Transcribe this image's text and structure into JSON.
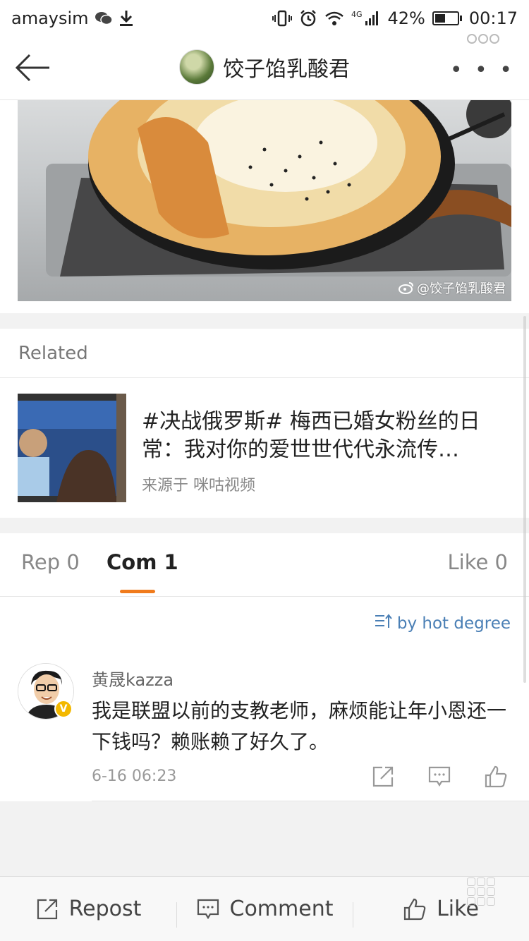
{
  "status_bar": {
    "carrier": "amaysim",
    "network": "4G",
    "battery": "42%",
    "time": "00:17"
  },
  "header": {
    "title": "饺子馅乳酸君",
    "more_label": "• • •"
  },
  "post_image": {
    "watermark": "@饺子馅乳酸君"
  },
  "related": {
    "title": "Related",
    "item": {
      "headline": "#决战俄罗斯# 梅西已婚女粉丝的日常：我对你的爱世世代代永流传…",
      "source": "来源于 咪咕视频"
    }
  },
  "tabs": {
    "repost": "Rep 0",
    "comments": "Com 1",
    "likes": "Like 0"
  },
  "sort_label": "by hot degree",
  "comment": {
    "author": "黄晟kazza",
    "text": "我是联盟以前的支教老师，麻烦能让年小恩还一下钱吗？赖账赖了好久了。",
    "time": "6-16 06:23"
  },
  "toolbar": {
    "repost": "Repost",
    "comment": "Comment",
    "like": "Like"
  },
  "colors": {
    "accent": "#f07b1c",
    "link": "#4a7fb5",
    "verified": "#f3b800"
  }
}
